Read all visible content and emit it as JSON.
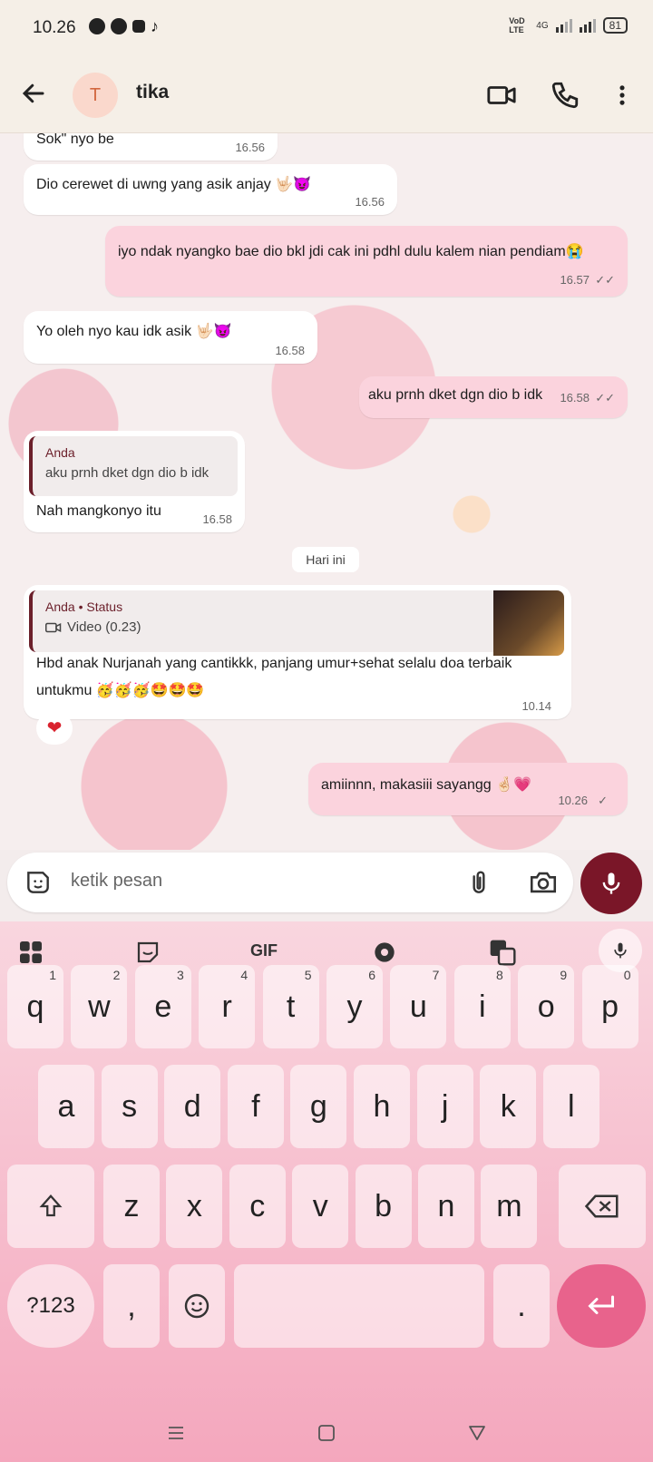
{
  "status_bar": {
    "time": "10.26",
    "network_label": "VoD LTE",
    "network_type": "4G",
    "battery": "81"
  },
  "header": {
    "avatar_initial": "T",
    "contact_name": "tika"
  },
  "messages": [
    {
      "dir": "in",
      "text": "Sok\" nyo be",
      "time": "16.56"
    },
    {
      "dir": "in",
      "text": "Dio cerewet di uwng yang asik anjay 🤟🏻😈",
      "time": "16.56"
    },
    {
      "dir": "out",
      "text": "iyo ndak nyangko bae dio bkl jdi cak ini pdhl dulu kalem nian pendiam😭",
      "time": "16.57",
      "ticks": "✓✓"
    },
    {
      "dir": "in",
      "text": "Yo oleh nyo kau idk asik 🤟🏻😈",
      "time": "16.58"
    },
    {
      "dir": "out",
      "text": "aku prnh dket dgn dio b idk",
      "time": "16.58",
      "ticks": "✓✓"
    },
    {
      "dir": "in",
      "quote_name": "Anda",
      "quote_text": "aku prnh dket dgn dio b idk",
      "text": "Nah mangkonyo itu",
      "time": "16.58"
    },
    {
      "dir": "in",
      "quote_name": "Anda • Status",
      "quote_text": "Video (0.23)",
      "text": "Hbd anak Nurjanah yang cantikkk, panjang umur+sehat selalu doa terbaik",
      "text2": "untukmu 🥳🥳🥳🤩🤩🤩",
      "time": "10.14",
      "reaction": "❤"
    },
    {
      "dir": "out",
      "text": "amiinnn, makasiii sayangg 🤞🏻💗",
      "time": "10.26",
      "ticks": "✓"
    }
  ],
  "date_divider": "Hari ini",
  "composer": {
    "placeholder": "ketik pesan"
  },
  "keyboard": {
    "toolbar": {
      "gif": "GIF"
    },
    "row1": [
      {
        "k": "q",
        "n": "1"
      },
      {
        "k": "w",
        "n": "2"
      },
      {
        "k": "e",
        "n": "3"
      },
      {
        "k": "r",
        "n": "4"
      },
      {
        "k": "t",
        "n": "5"
      },
      {
        "k": "y",
        "n": "6"
      },
      {
        "k": "u",
        "n": "7"
      },
      {
        "k": "i",
        "n": "8"
      },
      {
        "k": "o",
        "n": "9"
      },
      {
        "k": "p",
        "n": "0"
      }
    ],
    "row2": [
      "a",
      "s",
      "d",
      "f",
      "g",
      "h",
      "j",
      "k",
      "l"
    ],
    "row3": [
      "z",
      "x",
      "c",
      "v",
      "b",
      "n",
      "m"
    ],
    "symbols": "?123",
    "comma": ",",
    "period": "."
  },
  "colors": {
    "accent": "#7a1628",
    "outgoing_bubble": "#fbd3dd",
    "keyboard_bg": "#f4a7bd",
    "enter_key": "#e8638c"
  }
}
